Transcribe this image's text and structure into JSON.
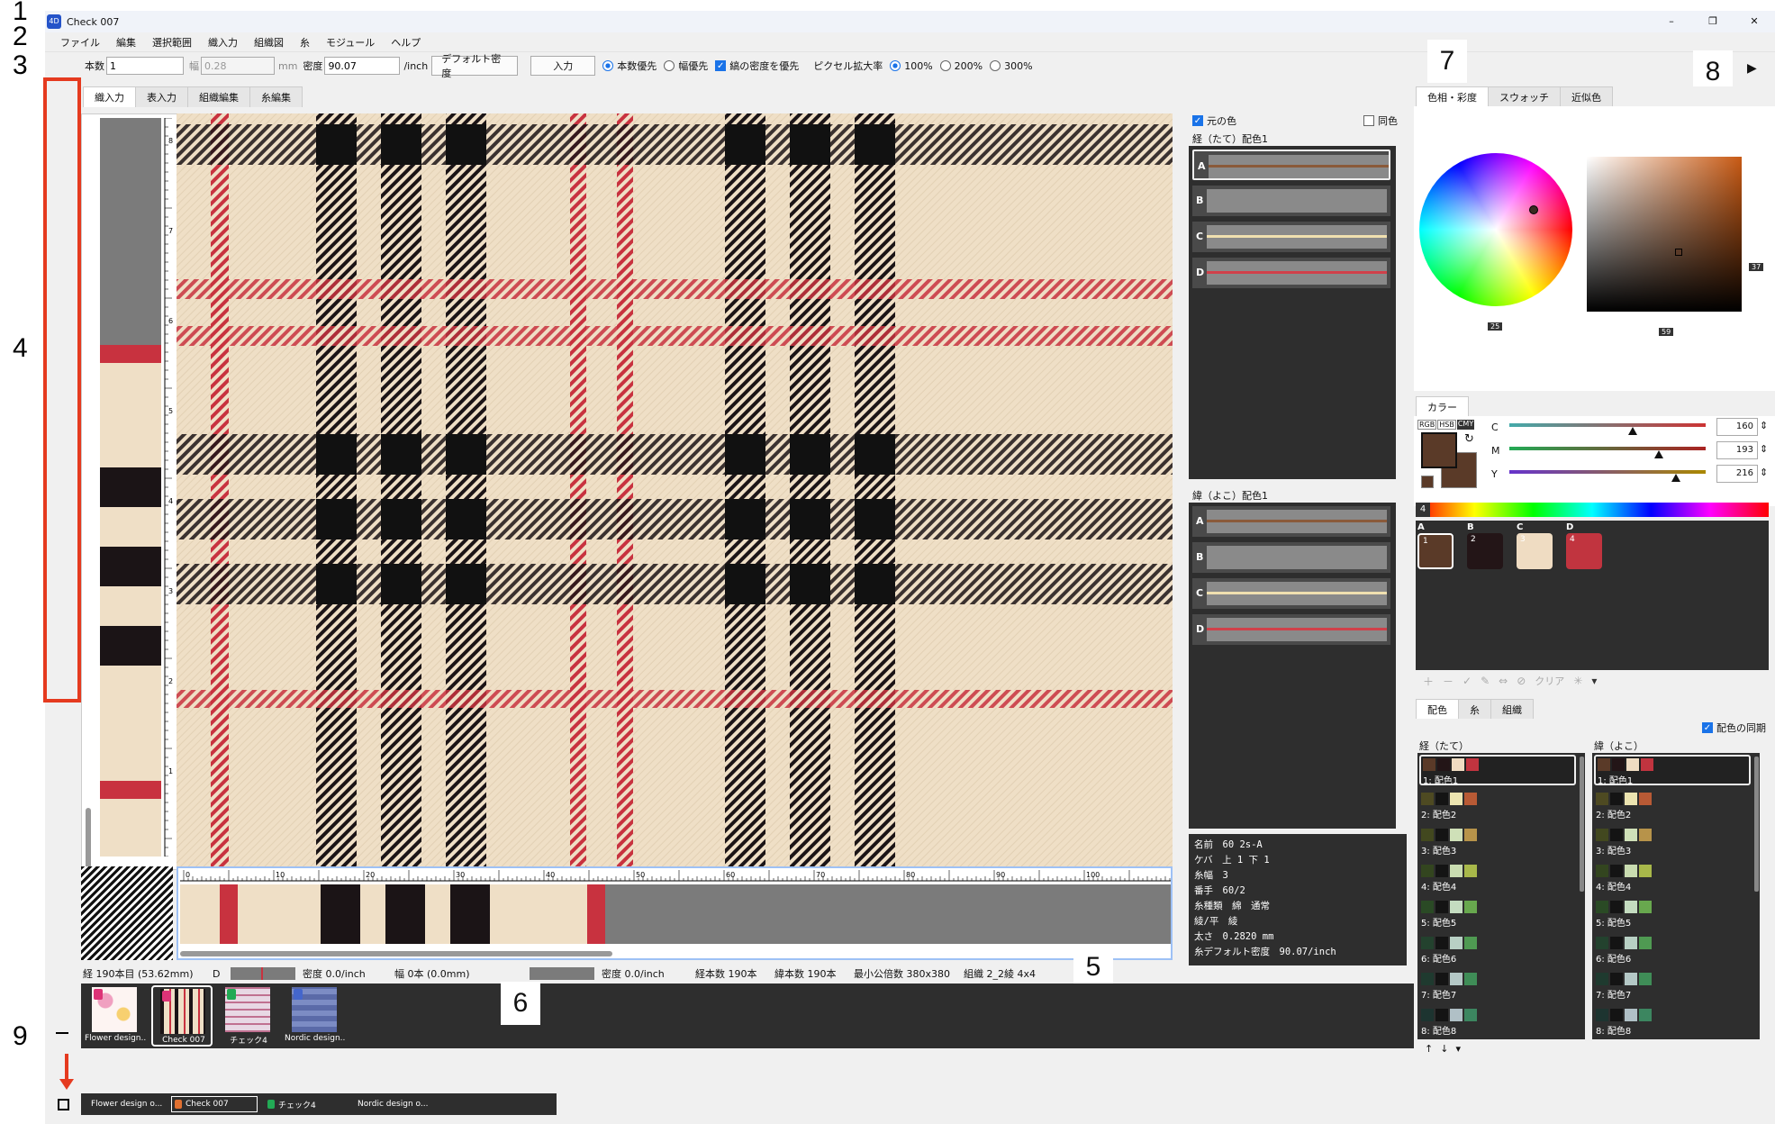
{
  "annotations": {
    "markers": [
      "1",
      "2",
      "3",
      "4",
      "5",
      "6",
      "7",
      "8",
      "9"
    ]
  },
  "window": {
    "title": "Check 007",
    "app_badge": "4D",
    "controls": [
      "–",
      "❐",
      "✕"
    ]
  },
  "menu": [
    "ファイル",
    "編集",
    "選択範囲",
    "織入力",
    "組織図",
    "糸",
    "モジュール",
    "ヘルプ"
  ],
  "toolbar": {
    "count_label": "本数",
    "count_value": "1",
    "width_label": "幅",
    "width_value": "0.28",
    "width_unit": "mm",
    "density_label": "密度",
    "density_value": "90.07",
    "density_unit": "/inch",
    "default_density_btn": "デフォルト密度",
    "enter_btn": "入力",
    "opt_count_priority": "本数優先",
    "opt_width_priority": "幅優先",
    "opt_stripe_density": "縞の密度を優先",
    "pixel_zoom_label": "ピクセル拡大率",
    "zoom_options": [
      "100%",
      "200%",
      "300%"
    ],
    "zoom_selected": "100%",
    "arrow": "▶"
  },
  "left_tabs": [
    "織入力",
    "表入力",
    "組織編集",
    "糸編集"
  ],
  "ruler_labels": [
    "8",
    "7",
    "6",
    "5",
    "4",
    "3",
    "2",
    "1",
    "0"
  ],
  "h_ruler_labels": [
    "0",
    "10",
    "20",
    "30",
    "40",
    "50",
    "60",
    "70",
    "80",
    "90",
    "100"
  ],
  "status_bar": {
    "warp_pos": "経 190本目 (53.62mm)",
    "d_label": "D",
    "density1": "密度 0.0/inch",
    "width": "幅 0本 (0.0mm)",
    "density2": "密度 0.0/inch",
    "warp_count": "経本数 190本",
    "weft_count": "緯本数 190本",
    "lcm": "最小公倍数 380x380",
    "weave": "組織 2_2綾 4x4"
  },
  "thumbnails": [
    {
      "label": "Flower design...",
      "kind": "flower"
    },
    {
      "label": "Check 007",
      "kind": "check"
    },
    {
      "label": "チェック4",
      "kind": "check4"
    },
    {
      "label": "Nordic design...",
      "kind": "nordic"
    }
  ],
  "taskbar": [
    {
      "label": "Flower design o..."
    },
    {
      "label": "Check 007"
    },
    {
      "label": "チェック4"
    },
    {
      "label": "Nordic design o..."
    }
  ],
  "color_panel": {
    "original_color": "元の色",
    "same_color": "同色",
    "warp_scheme_title": "経（たて）配色1",
    "weft_scheme_title": "緯（よこ）配色1",
    "rows": [
      "A",
      "B",
      "C",
      "D"
    ]
  },
  "yarn_info": [
    "名前　60 2s-A",
    "ケバ　上 1 下 1",
    "糸幅　3",
    "番手　60/2",
    "糸種類　綿　通常",
    "綾/平　綾",
    "太さ　0.2820 mm",
    "糸デフォルト密度　90.07/inch"
  ],
  "right_tabs": [
    "色相・彩度",
    "スウォッチ",
    "近似色"
  ],
  "picker_badges": {
    "wheel": "25",
    "square_x": "59",
    "square_y": "37"
  },
  "color_section": {
    "tab": "カラー",
    "modes": [
      "RGB",
      "HSB",
      "CMY"
    ],
    "sliders": [
      {
        "name": "C",
        "value": "160",
        "pos": 0.63
      },
      {
        "name": "M",
        "value": "193",
        "pos": 0.76
      },
      {
        "name": "Y",
        "value": "216",
        "pos": 0.85
      }
    ],
    "palette_count": "4",
    "swatches": [
      {
        "letter": "A",
        "num": "1",
        "color": "#5a3a28"
      },
      {
        "letter": "B",
        "num": "2",
        "color": "#231517"
      },
      {
        "letter": "C",
        "num": "3",
        "color": "#efdcc2"
      },
      {
        "letter": "D",
        "num": "4",
        "color": "#c1343f"
      }
    ],
    "clear_label": "クリア"
  },
  "bottom_tabs": [
    "配色",
    "糸",
    "組織"
  ],
  "sync_label": "配色の同期",
  "warp_col_title": "経（たて）",
  "weft_col_title": "緯（よこ）",
  "schemes": [
    {
      "label": "1: 配色1",
      "colors": [
        "#5a3a28",
        "#231517",
        "#efdcc2",
        "#c1343f"
      ]
    },
    {
      "label": "2: 配色2",
      "colors": [
        "#4e4a22",
        "#141414",
        "#ece4b0",
        "#b85a35"
      ]
    },
    {
      "label": "3: 配色3",
      "colors": [
        "#42481f",
        "#141414",
        "#cfe0b8",
        "#b7934a"
      ]
    },
    {
      "label": "4: 配色4",
      "colors": [
        "#33451f",
        "#141414",
        "#c9dcb0",
        "#a8b84a"
      ]
    },
    {
      "label": "5: 配色5",
      "colors": [
        "#2a4a25",
        "#141414",
        "#c4dcc0",
        "#68a84e"
      ]
    },
    {
      "label": "6: 配色6",
      "colors": [
        "#23422e",
        "#141414",
        "#b8d0c4",
        "#4f9a52"
      ]
    },
    {
      "label": "7: 配色7",
      "colors": [
        "#1f3a2f",
        "#141414",
        "#b4c8c6",
        "#3f8d57"
      ]
    },
    {
      "label": "8: 配色8",
      "colors": [
        "#1d3430",
        "#141414",
        "#b0c0c6",
        "#3c8660"
      ]
    }
  ],
  "colors": {
    "beige": "#efdfc6",
    "black": "#1b1416",
    "red": "#c8323f",
    "gray": "#7b7b7b",
    "dark_panel": "#2e2e2e",
    "highlight": "#e53a1f"
  }
}
